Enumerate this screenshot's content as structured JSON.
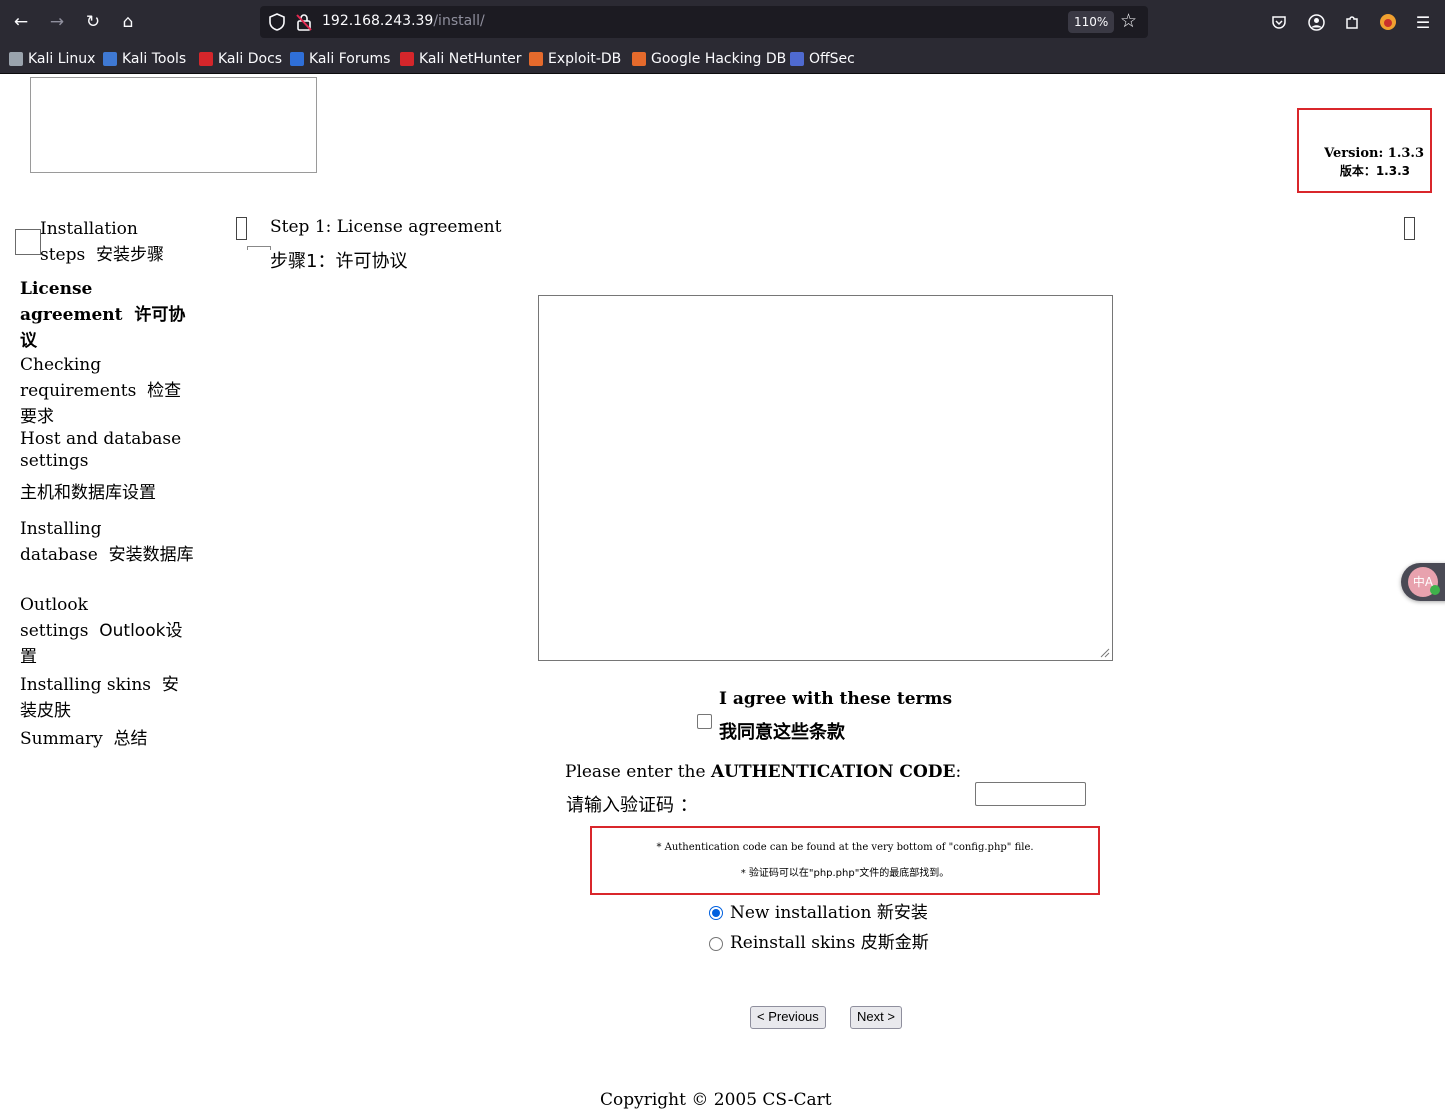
{
  "browser": {
    "url_host": "192.168.243.39",
    "url_path": "/install/",
    "zoom": "110%",
    "bookmarks": [
      {
        "label": "Kali Linux",
        "color": "#9aa3ad"
      },
      {
        "label": "Kali Tools",
        "color": "#3f79d4"
      },
      {
        "label": "Kali Docs",
        "color": "#d5262b"
      },
      {
        "label": "Kali Forums",
        "color": "#2f6fd8"
      },
      {
        "label": "Kali NetHunter",
        "color": "#d5262b"
      },
      {
        "label": "Exploit-DB",
        "color": "#e56a2c"
      },
      {
        "label": "Google Hacking DB",
        "color": "#e56a2c"
      },
      {
        "label": "OffSec",
        "color": "#4f6ad0"
      }
    ]
  },
  "version": {
    "en": "Version: 1.3.3",
    "zh": "版本：1.3.3"
  },
  "sidebar": {
    "heading_en": "Installation steps",
    "heading_zh": "安装步骤",
    "items": [
      {
        "en": "License agreement",
        "zh": "许可协议"
      },
      {
        "en": "Checking requirements",
        "zh": "检查要求"
      },
      {
        "en": "Host and database settings",
        "zh": "主机和数据库设置"
      },
      {
        "en": "Installing database",
        "zh": "安装数据库"
      },
      {
        "en": "Outlook settings",
        "zh": "Outlook设置"
      },
      {
        "en": "Installing skins",
        "zh": "安装皮肤"
      },
      {
        "en": "Summary",
        "zh": "总结"
      }
    ]
  },
  "step": {
    "title_en": "Step 1:  License agreement",
    "title_zh": "步骤1：许可协议"
  },
  "agree": {
    "en": "I agree with these terms",
    "zh": "我同意这些条款"
  },
  "auth": {
    "prefix_en": "Please enter the ",
    "bold_en": "AUTHENTICATION CODE",
    "suffix_en": ":",
    "zh": "请输入验证码 ：",
    "value": ""
  },
  "note": {
    "en": "* Authentication code can be found at the very bottom of \"config.php\" file.",
    "zh": "* 验证码可以在\"php.php\"文件的最底部找到。"
  },
  "install_type": {
    "options": [
      {
        "label": "New installation  新安装",
        "selected": true
      },
      {
        "label": "Reinstall skins  皮斯金斯",
        "selected": false
      }
    ]
  },
  "buttons": {
    "previous": "< Previous",
    "next": "Next >"
  },
  "footer": {
    "copyright": "Copyright © 2005 CS-Cart"
  }
}
